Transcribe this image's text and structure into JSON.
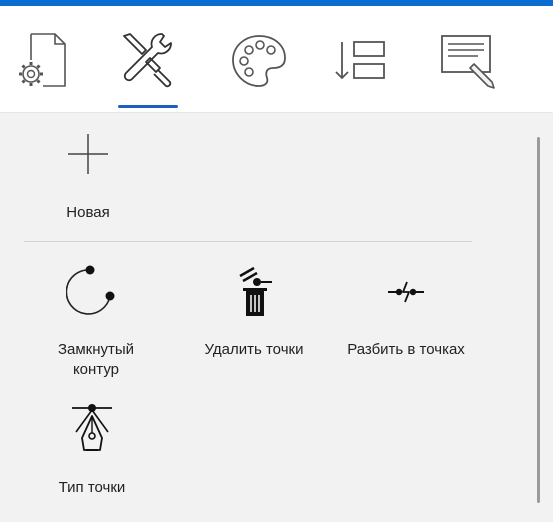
{
  "theme": {
    "accent": "#0a6ccf",
    "tab_underline": "#1f5fbf",
    "panel_bg": "#f2f2f2"
  },
  "tabs": [
    {
      "icon": "page-settings-icon",
      "selected": false
    },
    {
      "icon": "tools-icon",
      "selected": true
    },
    {
      "icon": "palette-icon",
      "selected": false
    },
    {
      "icon": "sort-order-icon",
      "selected": false
    },
    {
      "icon": "text-edit-icon",
      "selected": false
    }
  ],
  "commands": {
    "new": {
      "label": "Новая",
      "icon": "plus-icon"
    },
    "closed_path": {
      "label": "Замкнутый\nконтур",
      "icon": "closed-path-icon"
    },
    "delete_points": {
      "label": "Удалить точки",
      "icon": "delete-points-icon"
    },
    "split_points": {
      "label": "Разбить в точках",
      "icon": "split-path-icon"
    },
    "point_type": {
      "label": "Тип точки",
      "icon": "pen-point-type-icon"
    }
  }
}
